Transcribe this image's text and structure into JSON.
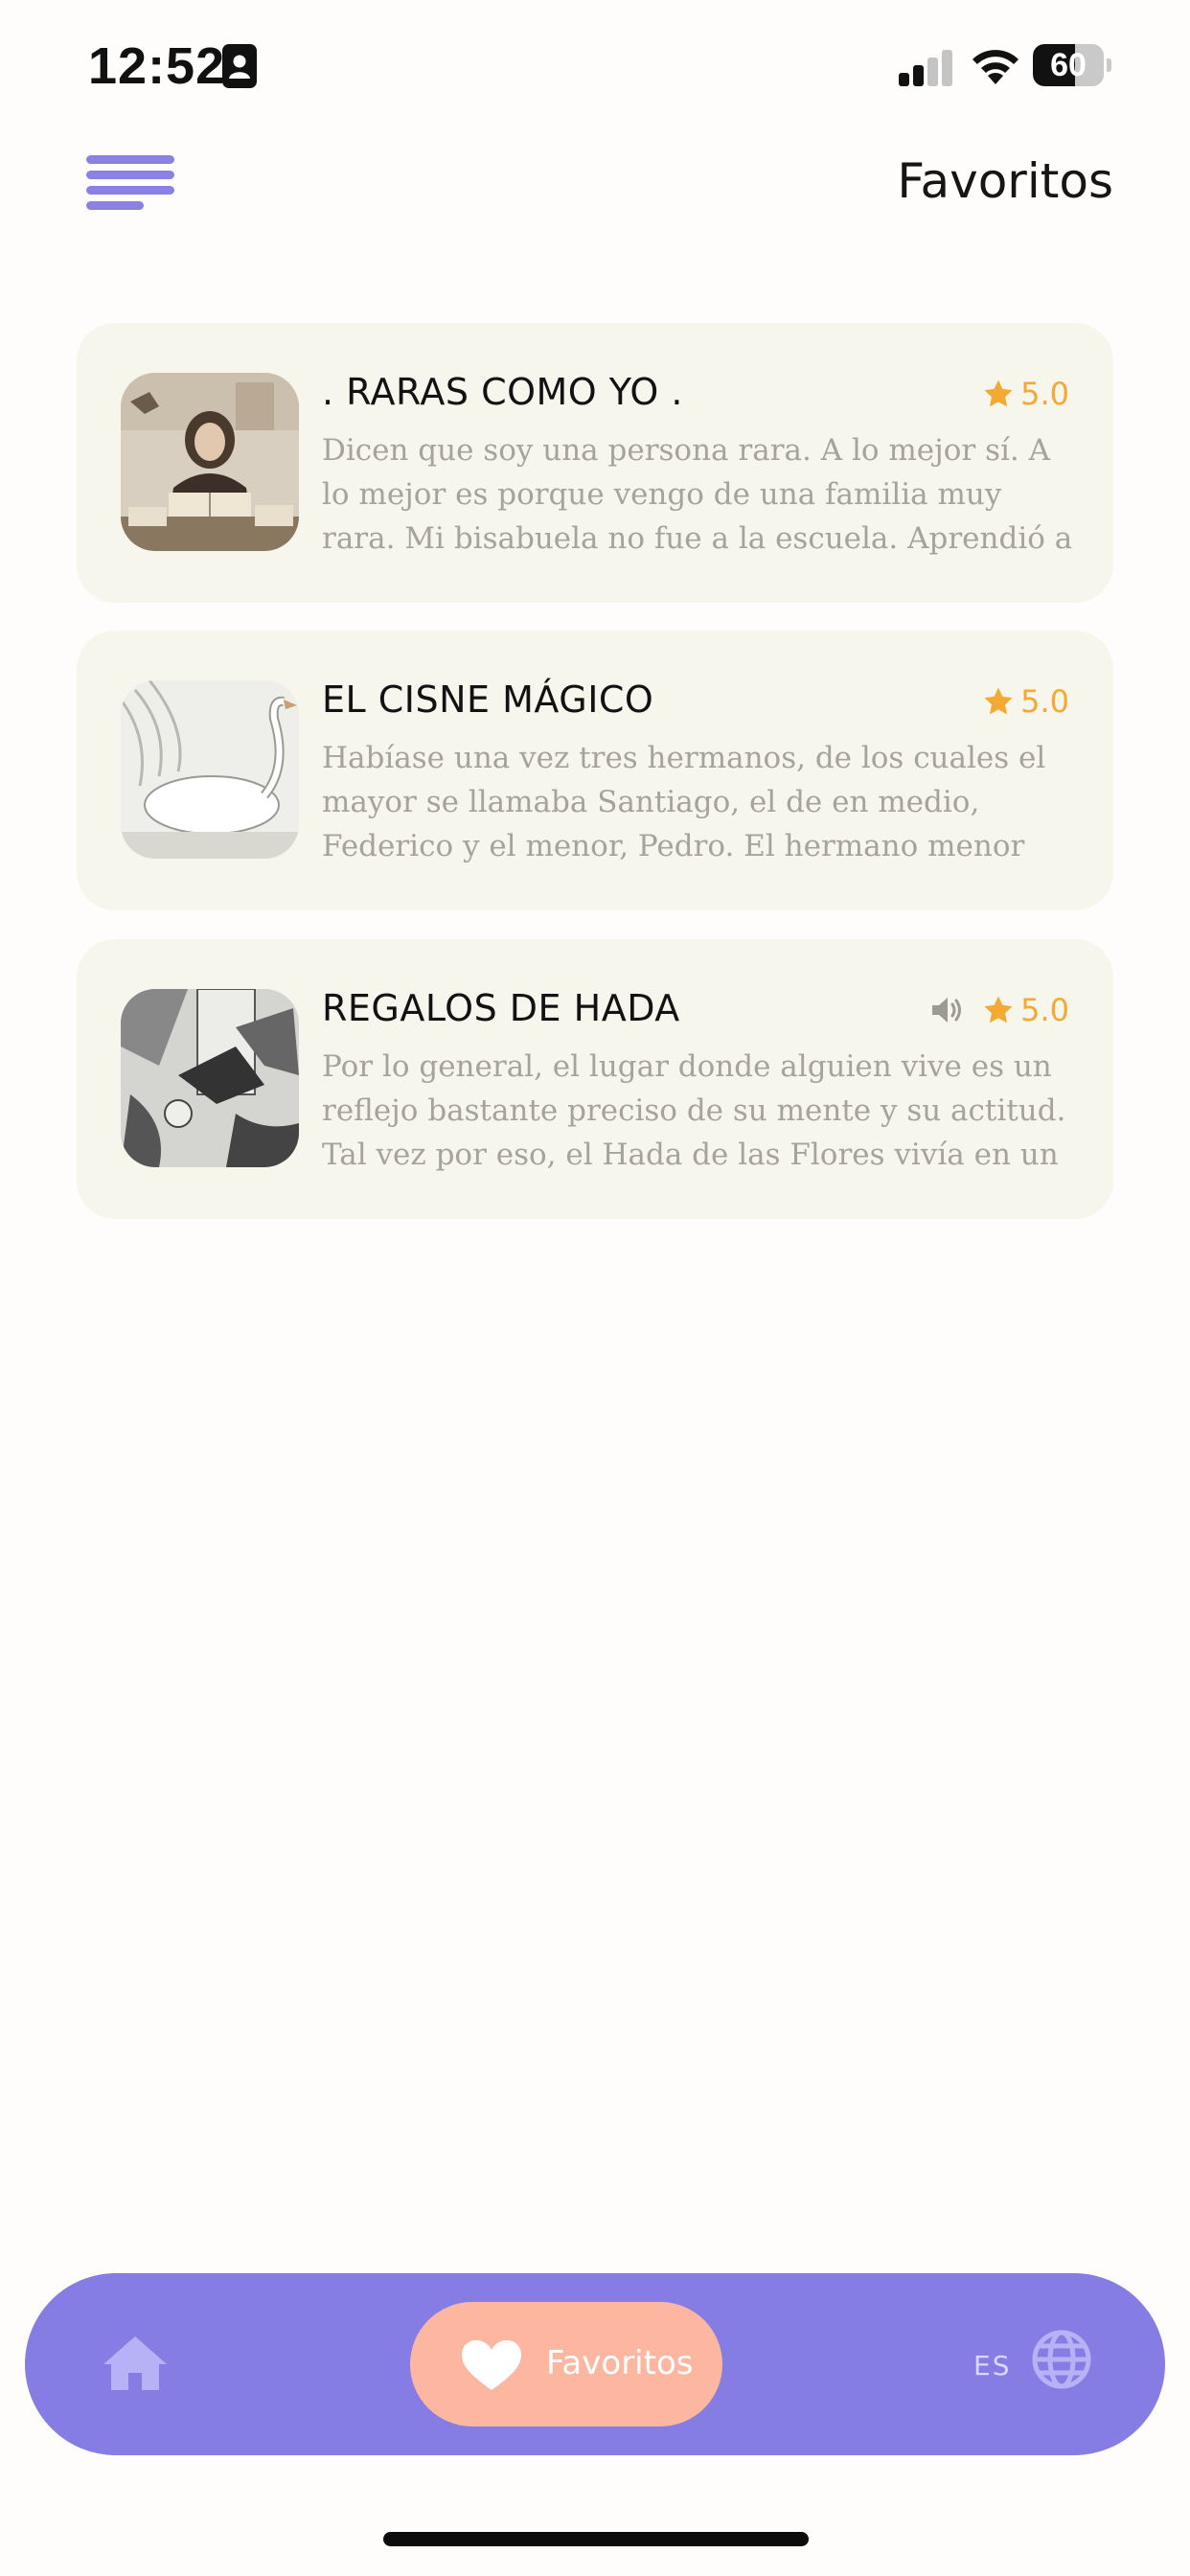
{
  "status_bar": {
    "time": "12:52",
    "battery": "60",
    "battery_level": 0.6
  },
  "header": {
    "title": "Favoritos",
    "menu_icon": "hamburger-menu-icon"
  },
  "stories": [
    {
      "title": ". RARAS COMO YO .",
      "rating": "5.0",
      "has_audio": false,
      "excerpt": "Dicen que soy una persona rara. A lo mejor sí. A lo mejor es porque vengo de una familia muy rara. Mi bisabuela no fue a la escuela. Aprendió a leer solita y"
    },
    {
      "title": "EL CISNE MÁGICO",
      "rating": "5.0",
      "has_audio": false,
      "excerpt": "Habíase una vez tres hermanos, de los cuales el mayor se llamaba Santiago, el de en medio, Federico y el menor, Pedro. El hermano menor era el puerquito de los otros"
    },
    {
      "title": "REGALOS DE HADA",
      "rating": "5.0",
      "has_audio": true,
      "excerpt": "Por lo general, el lugar donde alguien vive es un reflejo bastante preciso de su mente y su actitud. Tal vez por eso, el Hada de las Flores vivía en un palacio"
    }
  ],
  "bottom_nav": {
    "home_icon": "home-icon",
    "favorites_label": "Favoritos",
    "favorites_icon": "heart-icon",
    "language_code": "ES",
    "language_icon": "globe-icon"
  },
  "colors": {
    "accent": "#857de4",
    "active_pill": "#fdb6a0",
    "card_bg": "#f7f6ec",
    "star": "#f3a934"
  }
}
